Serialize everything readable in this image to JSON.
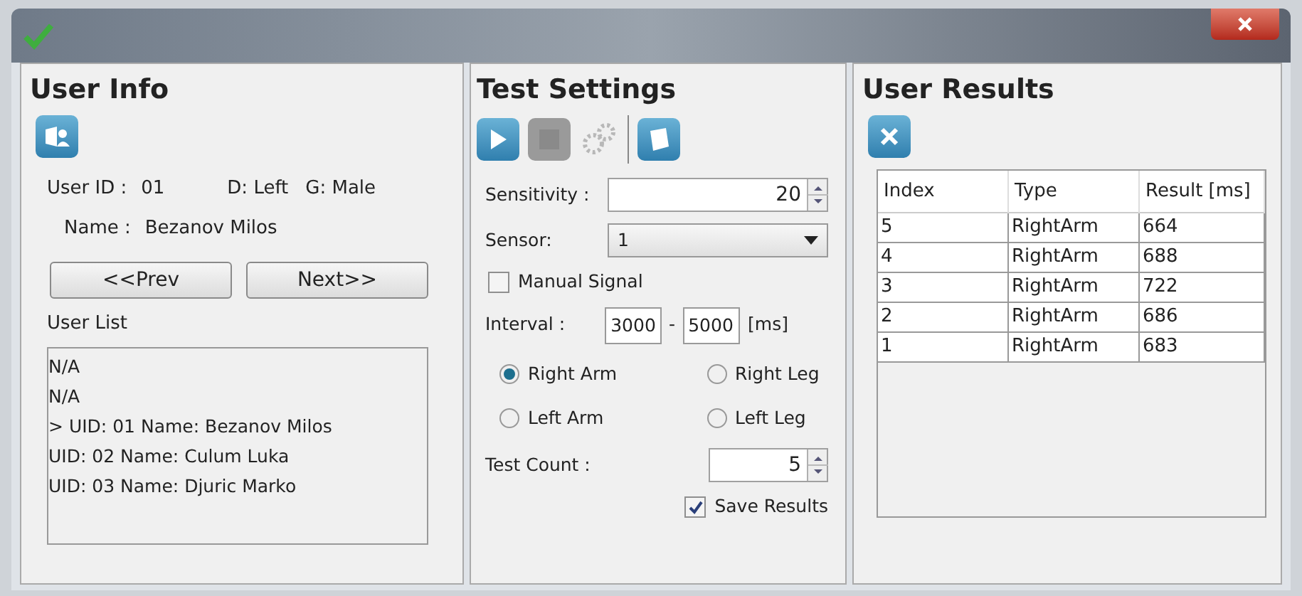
{
  "user_info": {
    "title": "User Info",
    "user_id_label": "User ID :",
    "user_id": "01",
    "dominance": "D:  Left",
    "gender": "G:  Male",
    "name_label": "Name :",
    "name": "Bezanov Milos",
    "prev_button": "<<Prev",
    "next_button": "Next>>",
    "list_label": "User List",
    "users": [
      "N/A",
      "N/A",
      "> UID: 01 Name: Bezanov Milos",
      "UID: 02 Name: Culum Luka",
      "UID: 03 Name: Djuric Marko"
    ]
  },
  "test_settings": {
    "title": "Test Settings",
    "stop_disabled": true,
    "settings_disabled": true,
    "sensitivity_label": "Sensitivity :",
    "sensitivity": "20",
    "sensor_label": "Sensor:",
    "sensor": "1",
    "manual_signal": {
      "label": "Manual Signal",
      "checked": false
    },
    "interval_label": "Interval :",
    "interval_from": "3000",
    "interval_dash": "-",
    "interval_to": "5000",
    "interval_unit": "[ms]",
    "limbs": [
      {
        "label": "Right Arm",
        "selected": true
      },
      {
        "label": "Right Leg",
        "selected": false
      },
      {
        "label": "Left Arm",
        "selected": false
      },
      {
        "label": "Left Leg",
        "selected": false
      }
    ],
    "test_count_label": "Test Count :",
    "test_count": "5",
    "save_results": {
      "label": "Save Results",
      "checked": true
    }
  },
  "user_results": {
    "title": "User Results",
    "columns": [
      "Index",
      "Type",
      "Result [ms]"
    ],
    "rows": [
      [
        "5",
        "RightArm",
        "664"
      ],
      [
        "4",
        "RightArm",
        "688"
      ],
      [
        "3",
        "RightArm",
        "722"
      ],
      [
        "2",
        "RightArm",
        "686"
      ],
      [
        "1",
        "RightArm",
        "683"
      ]
    ]
  }
}
